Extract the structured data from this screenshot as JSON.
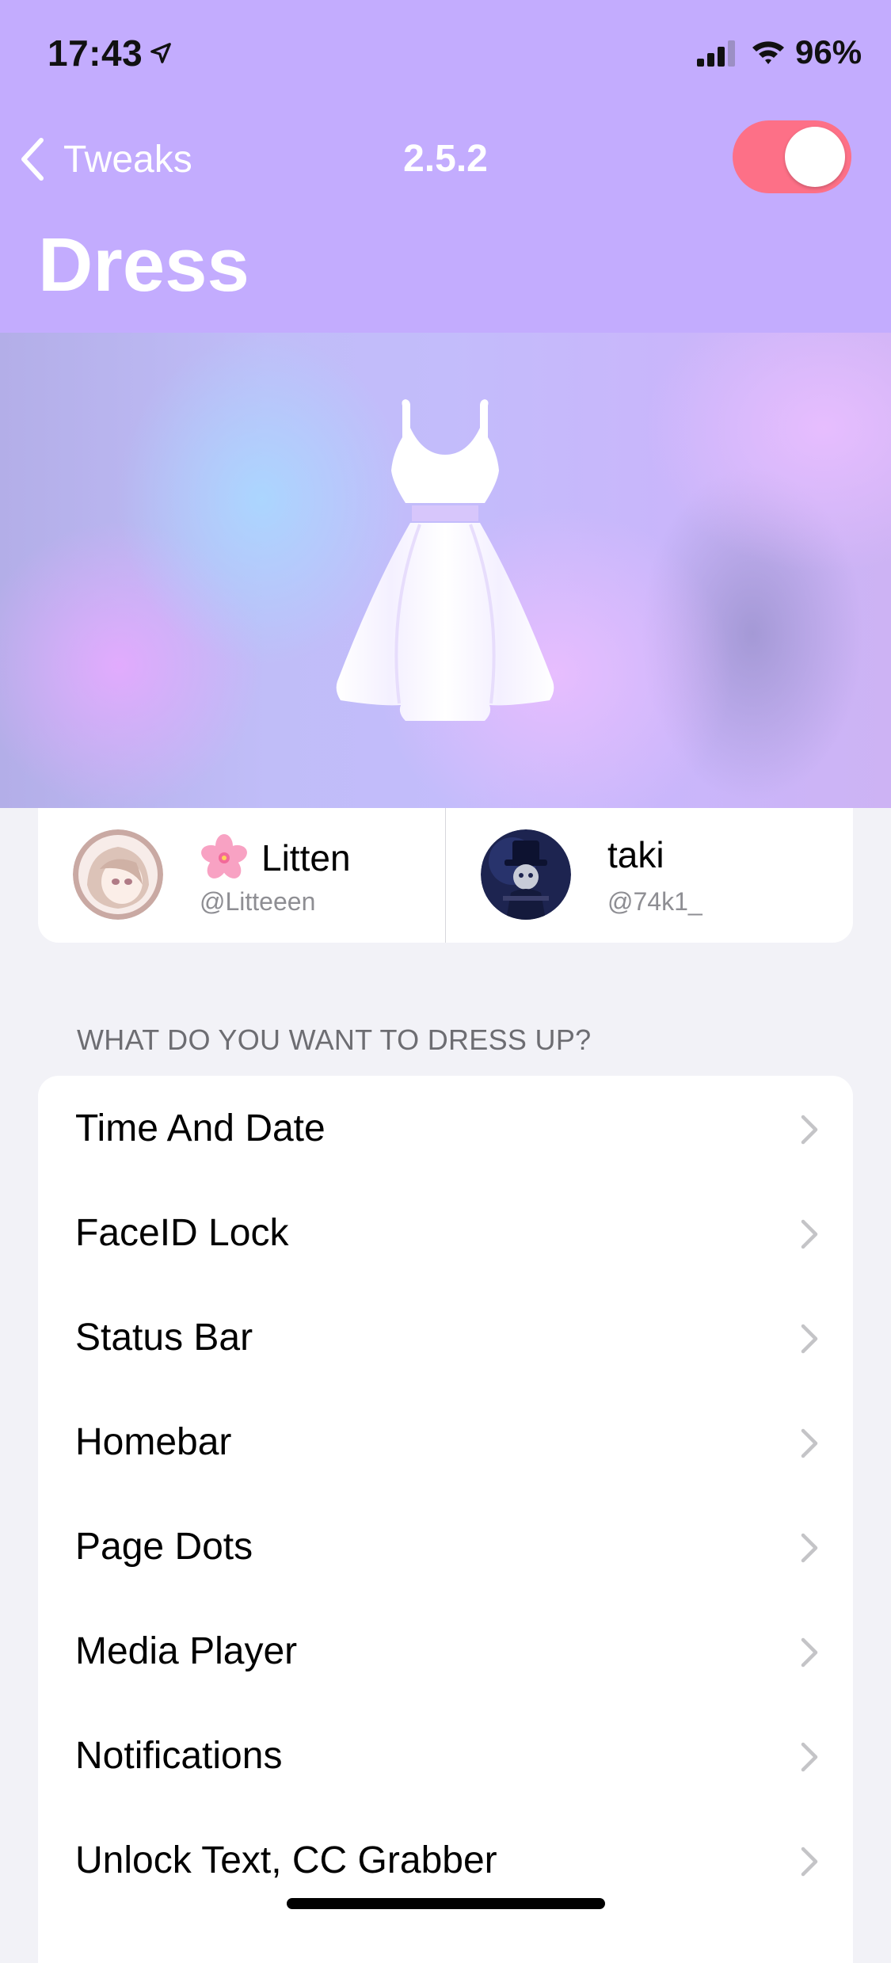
{
  "status_bar": {
    "time": "17:43",
    "battery_percent": "96%",
    "icons": [
      "location-arrow-icon",
      "cellular-signal-icon",
      "wifi-icon"
    ]
  },
  "nav": {
    "back_label": "Tweaks",
    "version": "2.5.2",
    "enabled": true,
    "title": "Dress"
  },
  "colors": {
    "header_background": "#c3acfe",
    "toggle_on": "#fd7087",
    "page_background": "#f2f2f7"
  },
  "banner": {
    "icon": "dress-icon"
  },
  "authors": [
    {
      "name": "Litten",
      "handle": "@Litteeen",
      "emoji_icon": "cherry-blossom-icon"
    },
    {
      "name": "taki",
      "handle": "@74k1_"
    }
  ],
  "section": {
    "header": "WHAT DO YOU WANT TO DRESS UP?",
    "items": [
      {
        "label": "Time And Date"
      },
      {
        "label": "FaceID Lock"
      },
      {
        "label": "Status Bar"
      },
      {
        "label": "Homebar"
      },
      {
        "label": "Page Dots"
      },
      {
        "label": "Media Player"
      },
      {
        "label": "Notifications"
      },
      {
        "label": "Unlock Text, CC Grabber"
      }
    ]
  }
}
